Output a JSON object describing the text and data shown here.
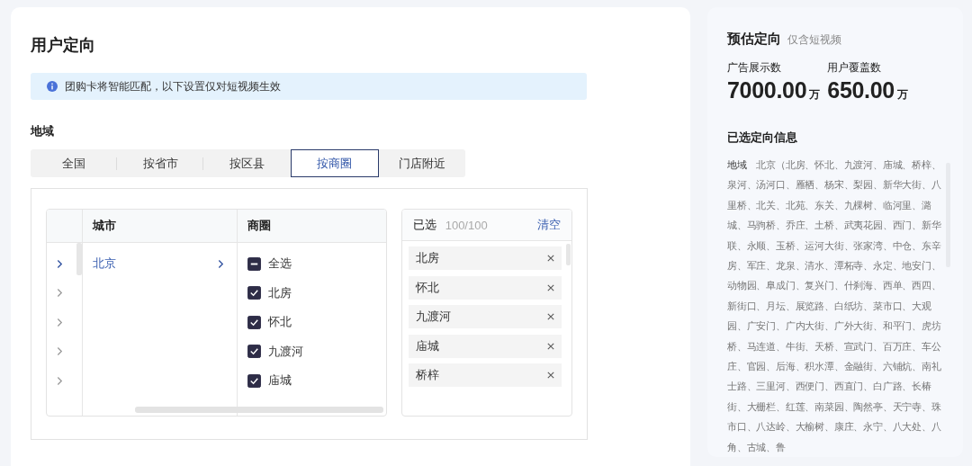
{
  "main": {
    "title": "用户定向",
    "notice": "团购卡将智能匹配，以下设置仅对短视频生效",
    "region_label": "地域",
    "tabs": [
      {
        "label": "全国",
        "selected": false
      },
      {
        "label": "按省市",
        "selected": false
      },
      {
        "label": "按区县",
        "selected": false
      },
      {
        "label": "按商圈",
        "selected": true
      },
      {
        "label": "门店附近",
        "selected": false
      }
    ],
    "cascader": {
      "columns": [
        "城市",
        "商圈"
      ],
      "toggles": [
        {
          "selected": true
        },
        {
          "selected": false
        },
        {
          "selected": false
        },
        {
          "selected": false
        },
        {
          "selected": false
        }
      ],
      "cities": [
        {
          "label": "北京",
          "selected": true
        }
      ],
      "areas": [
        {
          "label": "全选",
          "indeterminate": true
        },
        {
          "label": "北房",
          "checked": true,
          "indeterminate": false
        },
        {
          "label": "怀北",
          "checked": true,
          "indeterminate": false
        },
        {
          "label": "九渡河",
          "checked": true,
          "indeterminate": false
        },
        {
          "label": "庙城",
          "checked": true,
          "indeterminate": false
        }
      ]
    },
    "chosen": {
      "title": "已选",
      "count": "100/100",
      "clear": "清空",
      "items": [
        "北房",
        "怀北",
        "九渡河",
        "庙城",
        "桥梓"
      ]
    }
  },
  "side": {
    "title": "预估定向",
    "subtitle": "仅含短视频",
    "stats": [
      {
        "label": "广告展示数",
        "value": "7000.00",
        "unit": "万"
      },
      {
        "label": "用户覆盖数",
        "value": "650.00",
        "unit": "万"
      }
    ],
    "info_title": "已选定向信息",
    "info_text": "**地域**　北京（北房、怀北、九渡河、庙城、桥梓、泉河、汤河口、雁栖、杨宋、梨园、新华大街、八里桥、北关、北苑、东关、九棵树、临河里、潞城、马驹桥、乔庄、土桥、武夷花园、西门、新华联、永顺、玉桥、运河大街、张家湾、中仓、东辛房、军庄、龙泉、清水、潭柘寺、永定、地安门、动物园、阜成门、复兴门、什刹海、西单、西四、新街口、月坛、展览路、白纸坊、菜市口、大观园、广安门、广内大街、广外大街、和平门、虎坊桥、马连道、牛街、天桥、宣武门、百万庄、车公庄、官园、后海、积水潭、金融街、六铺炕、南礼士路、三里河、西便门、西直门、白广路、长椿街、大栅栏、红莲、南菜园、陶然亭、天宁寺、珠市口、八达岭、大榆树、康庄、永宁、八大处、八角、古城、鲁"
  }
}
